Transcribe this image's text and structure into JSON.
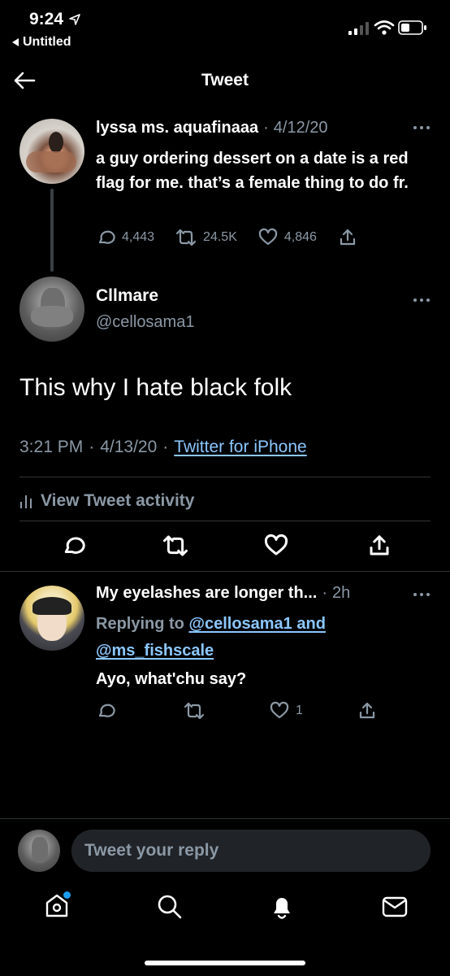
{
  "status_bar": {
    "time": "9:24",
    "back_app": "Untitled"
  },
  "header": {
    "title": "Tweet",
    "back_icon": "arrow-left-icon"
  },
  "parent_tweet": {
    "name": "lyssa ms. aquafinaaa",
    "date": "4/12/20",
    "text": "a guy ordering dessert on a date is a red flag for me. that’s a female thing to do fr.",
    "replies": "4,443",
    "retweets": "24.5K",
    "likes": "4,846"
  },
  "main_tweet": {
    "name": "Cllmare",
    "handle": "@cellosama1",
    "text": "This why I hate black folk",
    "time": "3:21 PM",
    "date": "4/13/20",
    "source": "Twitter for iPhone",
    "activity_label": "View Tweet activity"
  },
  "reply_tweet": {
    "name": "My eyelashes are longer th...",
    "time": "2h",
    "replying_prefix": "Replying to",
    "replying_handles": "@cellosama1 and",
    "replying_handles_2": "@ms_fishscale",
    "text": "Ayo, what'chu say?",
    "likes": "1"
  },
  "composer": {
    "placeholder": "Tweet your reply"
  },
  "tab_bar": {
    "items": [
      "home-icon",
      "search-icon",
      "notifications-icon",
      "messages-icon"
    ]
  },
  "colors": {
    "background": "#000000",
    "muted": "#8b98a5",
    "link": "#8cc7ff",
    "notification_dot": "#1d9bf0"
  }
}
